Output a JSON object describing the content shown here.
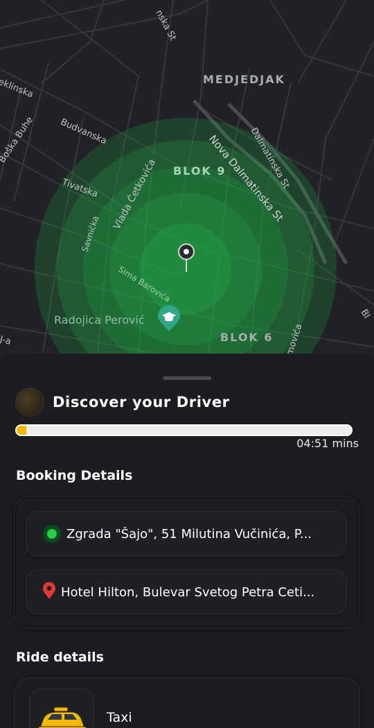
{
  "map": {
    "districts": [
      "MEDJEDJAK",
      "BLOK 9",
      "BLOK 6"
    ],
    "streets": [
      "nska St",
      "eklinska",
      "Boška Buhe",
      "Budvanska",
      "Dalmatinska St",
      "Nova Dalmatinska St",
      "Tivatska",
      "Vlada Ćetkovića",
      "Savnička",
      "Sima Barovića",
      "J-a",
      "movića",
      "Bl"
    ],
    "poi": {
      "name": "Radojica Perović",
      "icon": "school-icon"
    },
    "pin_icon": "location-pin-icon"
  },
  "sheet": {
    "driver_title": "Discover your Driver",
    "progress": 0.03,
    "timer": "04:51 mins",
    "booking_title": "Booking Details",
    "pickup": "Zgrada \"Šajo\", 51 Milutina Vučinića, P...",
    "dropoff": "Hotel Hilton, Bulevar Svetog Petra Ceti...",
    "ride_title": "Ride details",
    "ride_type": "Taxi",
    "colors": {
      "accent": "#f5b800",
      "pickup": "#25d04a",
      "dropoff": "#e53935",
      "map_circle": "#22b24a"
    }
  }
}
